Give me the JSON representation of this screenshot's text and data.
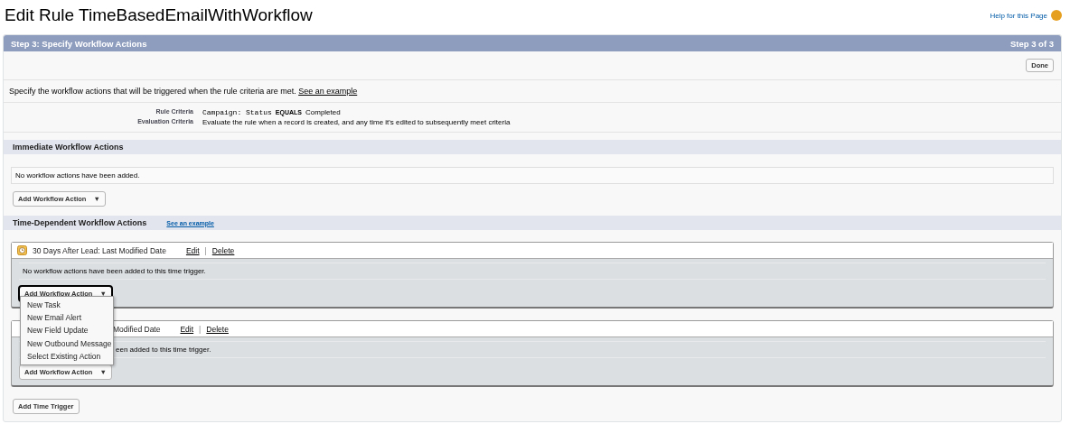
{
  "page_title": "Edit Rule TimeBasedEmailWithWorkflow",
  "help_link": "Help for this Page",
  "step_header": {
    "title": "Step 3: Specify Workflow Actions",
    "step": "Step 3 of 3"
  },
  "done_button": "Done",
  "description": {
    "text": "Specify the workflow actions that will be triggered when the rule criteria are met.",
    "link": "See an example"
  },
  "criteria": [
    {
      "label": "Rule Criteria",
      "field": "Campaign: Status",
      "operator": "EQUALS",
      "value": "Completed"
    },
    {
      "label": "Evaluation Criteria",
      "value": "Evaluate the rule when a record is created, and any time it's edited to subsequently meet criteria"
    }
  ],
  "immediate": {
    "title": "Immediate Workflow Actions",
    "empty_text": "No workflow actions have been added.",
    "add_button": "Add Workflow Action",
    "add_caret": "▼"
  },
  "time_dependent": {
    "title": "Time-Dependent Workflow Actions",
    "link": "See an example",
    "triggers": [
      {
        "title": "30 Days After Lead: Last Modified Date",
        "clock_icon": true,
        "edit": "Edit",
        "separator": "|",
        "delete": "Delete",
        "empty_text": "No workflow actions have been added to this time trigger.",
        "add_button": "Add Workflow Action",
        "add_caret": "▼",
        "focused": true
      },
      {
        "title": "Modified Date",
        "clock_icon": false,
        "edit": "Edit",
        "separator": "|",
        "delete": "Delete",
        "empty_text": "een added to this time trigger.",
        "add_button": "Add Workflow Action",
        "add_caret": "▼",
        "focused": false
      }
    ],
    "add_trigger_button": "Add Time Trigger"
  },
  "action_menu": {
    "open": true,
    "items": [
      "New Task",
      "New Email Alert",
      "New Field Update",
      "New Outbound Message",
      "Select Existing Action"
    ]
  }
}
